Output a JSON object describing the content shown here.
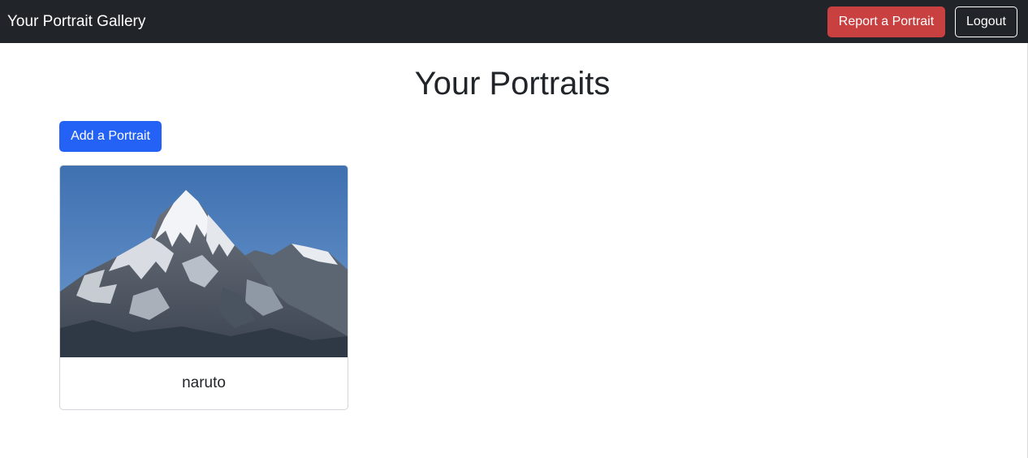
{
  "navbar": {
    "brand": "Your Portrait Gallery",
    "report_button": "Report a Portrait",
    "logout_button": "Logout"
  },
  "main": {
    "title": "Your Portraits",
    "add_button": "Add a Portrait",
    "portraits": [
      {
        "title": "naruto",
        "image": "snowy-mountain-peak-photo"
      }
    ]
  },
  "colors": {
    "navbar_bg": "#212529",
    "danger": "#c8403f",
    "primary": "#2462f5"
  }
}
